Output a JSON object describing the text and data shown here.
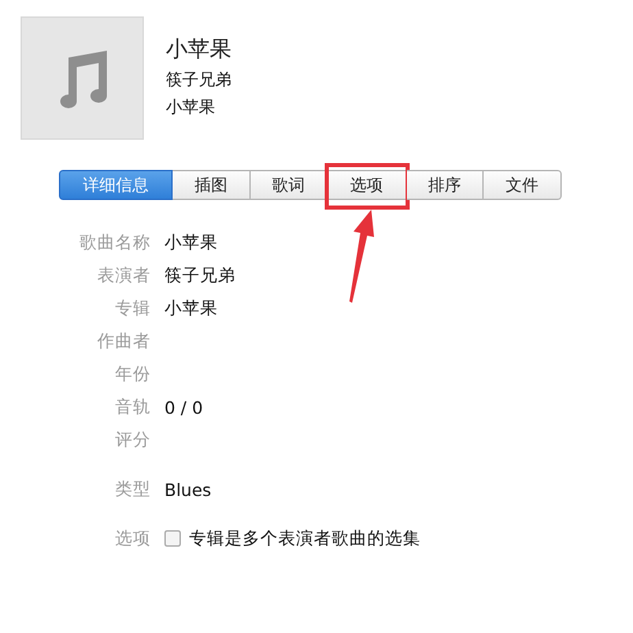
{
  "header": {
    "title": "小苹果",
    "artist": "筷子兄弟",
    "album": "小苹果"
  },
  "tabs": [
    {
      "label": "详细信息",
      "selected": true,
      "highlighted": false
    },
    {
      "label": "插图",
      "selected": false,
      "highlighted": false
    },
    {
      "label": "歌词",
      "selected": false,
      "highlighted": false
    },
    {
      "label": "选项",
      "selected": false,
      "highlighted": true
    },
    {
      "label": "排序",
      "selected": false,
      "highlighted": false
    },
    {
      "label": "文件",
      "selected": false,
      "highlighted": false
    }
  ],
  "field_groups": [
    [
      {
        "kind": "text",
        "label": "歌曲名称",
        "value": "小苹果"
      },
      {
        "kind": "text",
        "label": "表演者",
        "value": "筷子兄弟"
      },
      {
        "kind": "text",
        "label": "专辑",
        "value": "小苹果"
      },
      {
        "kind": "text",
        "label": "作曲者"
      },
      {
        "kind": "text",
        "label": "年份"
      },
      {
        "kind": "text",
        "label": "音轨",
        "value": "0  /  0"
      },
      {
        "kind": "text",
        "label": "评分"
      }
    ],
    [
      {
        "kind": "text",
        "label": "类型",
        "value": "Blues"
      }
    ],
    [
      {
        "kind": "checkbox",
        "label": "选项",
        "value": "专辑是多个表演者歌曲的选集",
        "checked": false
      }
    ]
  ]
}
